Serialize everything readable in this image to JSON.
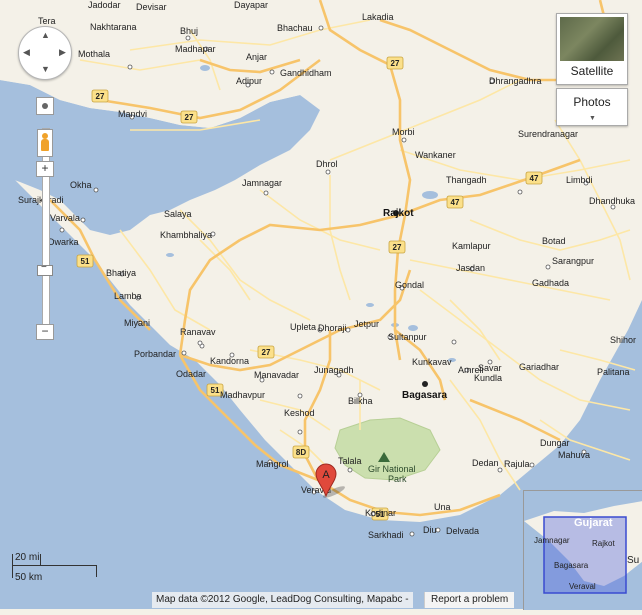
{
  "map": {
    "places": {
      "jadodar": "Jadodar",
      "devisar": "Devisar",
      "dayapar": "Dayapar",
      "lakadia": "Lakadia",
      "tera": "Tera",
      "nakhtarana": "Nakhtarana",
      "mothala": "Mothala",
      "bhuj": "Bhuj",
      "madhapar": "Madhapar",
      "bhachau": "Bhachau",
      "anjar": "Anjar",
      "gandhidham": "Gandhidham",
      "adipur": "Adipur",
      "mandvi": "Mandvi",
      "dhrangadhra": "Dhrangadhra",
      "morbi": "Morbi",
      "surendranagar": "Surendranagar",
      "wankaner": "Wankaner",
      "dhrol": "Dhrol",
      "thangadh": "Thangadh",
      "limbdi": "Limbdi",
      "okha": "Okha",
      "surajkaradi": "Surajkaradi",
      "varvala": "Varvala",
      "jamnagar": "Jamnagar",
      "salaya": "Salaya",
      "rajkot": "Rajkot",
      "dhandhuka": "Dhandhuka",
      "khambhaliya": "Khambhaliya",
      "dwarka": "Dwarka",
      "kamlapur": "Kamlapur",
      "botad": "Botad",
      "bhatiya": "Bhatiya",
      "sarangpur": "Sarangpur",
      "jasdan": "Jasdan",
      "gondal": "Gondal",
      "lamba": "Lamba",
      "gadhada": "Gadhada",
      "miyani": "Miyani",
      "upleta": "Upleta",
      "dhoraji": "Dhoraji",
      "jetpur": "Jetpur",
      "ranavav": "Ranavav",
      "sultanpur": "Sultanpur",
      "porbandar": "Porbandar",
      "kandorna": "Kandorna",
      "kunkavav": "Kunkavav",
      "shihor": "Shihor",
      "odadar": "Odadar",
      "junagadh": "Junagadh",
      "manavadar": "Manavadar",
      "amreli": "Amreli",
      "gariadhar": "Gariadhar",
      "palitana": "Palitana",
      "bagasara": "Bagasara",
      "madhavpur": "Madhavpur",
      "bilkha": "Bilkha",
      "savar_kundla": "Savar\nKundla",
      "keshod": "Keshod",
      "mangrol": "Mangrol",
      "talala": "Talala",
      "gir": "Gir National",
      "park": "Park",
      "dedan": "Dedan",
      "rajula": "Rajula",
      "dungar": "Dungar",
      "veraval": "Veraval",
      "kodinar": "Kodinar",
      "una": "Una",
      "sarkhadi": "Sarkhadi",
      "diu": "Diu",
      "delvada": "Delvada",
      "mahuva": "Mahuva"
    },
    "shields": [
      "27",
      "27",
      "27",
      "27",
      "47",
      "47",
      "27",
      "51",
      "27",
      "51",
      "8D",
      "51"
    ],
    "marker_letter": "A"
  },
  "controls": {
    "satellite_label": "Satellite",
    "photos_label": "Photos",
    "zoom_in": "+",
    "zoom_out": "−",
    "zoom_minus_mid": "−"
  },
  "scale": {
    "miles": "20 mi",
    "km": "50 km"
  },
  "footer": {
    "attribution": "Map data ©2012 Google, LeadDog Consulting, Mapabc -",
    "report": "Report a problem"
  },
  "overview": {
    "gujarat": "Gujarat",
    "jamnagar": "Jamnagar",
    "rajkot": "Rajkot",
    "bagasara": "Bagasara",
    "veraval": "Veraval",
    "su": "Su"
  },
  "colors": {
    "water": "#a5bfdd",
    "land": "#f4f1e8",
    "road_major": "#f7c46a",
    "road_minor": "#fde7a6",
    "park": "#cbdfae",
    "marker": "#e0493b"
  }
}
